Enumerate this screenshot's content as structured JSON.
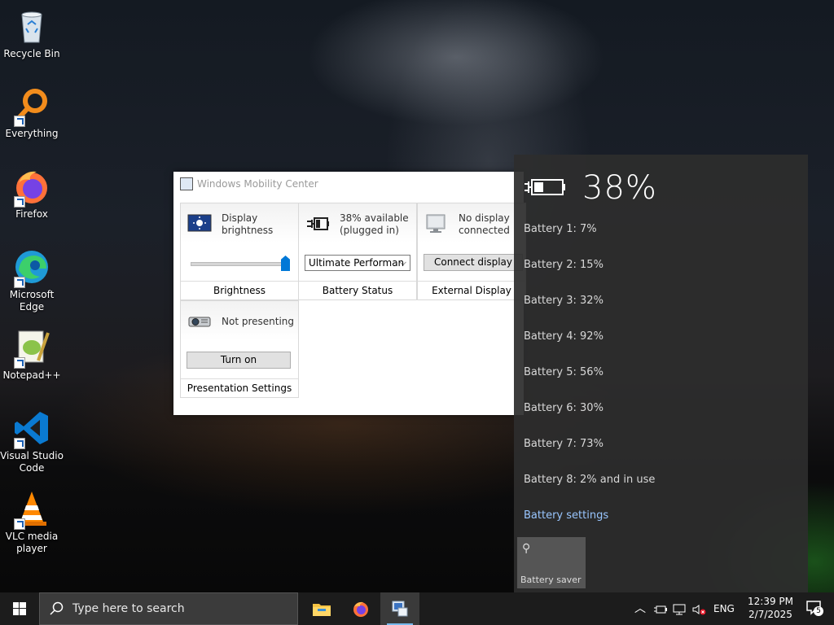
{
  "desktop": {
    "icons": [
      {
        "label": "Recycle Bin"
      },
      {
        "label": "Everything"
      },
      {
        "label": "Firefox"
      },
      {
        "label": "Microsoft Edge"
      },
      {
        "label": "Notepad++"
      },
      {
        "label": "Visual Studio Code"
      },
      {
        "label": "VLC media player"
      }
    ]
  },
  "mobility_center": {
    "title": "Windows Mobility Center",
    "brightness": {
      "line1": "Display",
      "line2": "brightness",
      "footer": "Brightness",
      "level": 1.0
    },
    "battery": {
      "line1": "38% available",
      "line2": "(plugged in)",
      "plan": "Ultimate Performan",
      "footer": "Battery Status"
    },
    "display": {
      "line1": "No display",
      "line2": "connected",
      "button": "Connect display",
      "footer": "External Display"
    },
    "presentation": {
      "status": "Not presenting",
      "button": "Turn on",
      "footer": "Presentation Settings"
    }
  },
  "battery_flyout": {
    "percent": "38%",
    "batteries": [
      "Battery 1: 7%",
      "Battery 2: 15%",
      "Battery 3: 32%",
      "Battery 4: 92%",
      "Battery 5: 56%",
      "Battery 6: 30%",
      "Battery 7: 73%",
      "Battery 8: 2% and in use"
    ],
    "settings_link": "Battery settings",
    "saver_label": "Battery saver"
  },
  "taskbar": {
    "search_placeholder": "Type here to search",
    "language": "ENG",
    "time": "12:39 PM",
    "date": "2/7/2025",
    "notification_count": "5"
  },
  "colors": {
    "accent": "#0078d7",
    "link": "#99c6ff",
    "taskbar": "#1c1c1c"
  }
}
